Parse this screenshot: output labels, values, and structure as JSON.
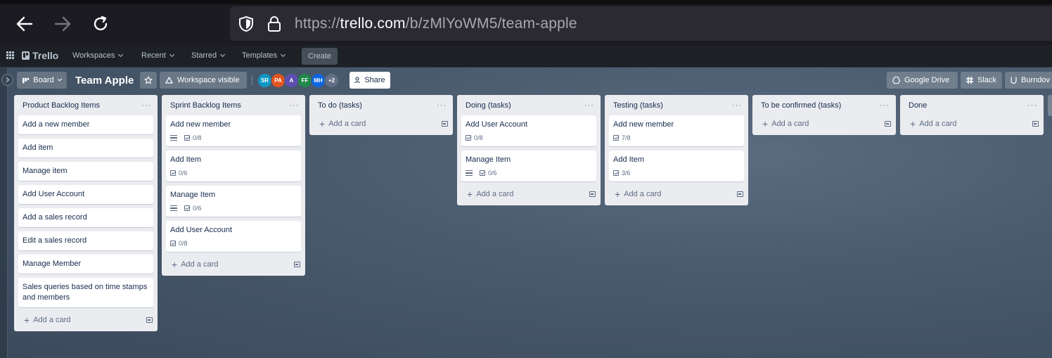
{
  "browser": {
    "url_host": "trello.com",
    "url_prefix": "https://",
    "url_path": "/b/zMlYoWM5/team-apple"
  },
  "header": {
    "logo": "Trello",
    "menus": [
      "Workspaces",
      "Recent",
      "Starred",
      "Templates"
    ],
    "create_label": "Create"
  },
  "board": {
    "view_label": "Board",
    "title": "Team Apple",
    "visibility_label": "Workspace visible",
    "members": [
      {
        "initials": "SR",
        "color": "#0e97c4"
      },
      {
        "initials": "PA",
        "color": "#e3541e"
      },
      {
        "initials": "A",
        "color": "#5e4db2"
      },
      {
        "initials": "FF",
        "color": "#1f8a4c"
      },
      {
        "initials": "MH",
        "color": "#0c66e4"
      },
      {
        "initials": "+2",
        "color": "#626f86"
      }
    ],
    "share_label": "Share",
    "powerups": [
      "Google Drive",
      "Slack",
      "Burndov"
    ]
  },
  "lists": [
    {
      "title": "Product Backlog Items",
      "cards": [
        {
          "title": "Add a new member"
        },
        {
          "title": "Add item"
        },
        {
          "title": "Manage item"
        },
        {
          "title": "Add User Account"
        },
        {
          "title": "Add a sales record"
        },
        {
          "title": "Edit a sales record"
        },
        {
          "title": "Manage Member"
        },
        {
          "title": "Sales queries based on time stamps and members"
        }
      ],
      "add_label": "Add a card"
    },
    {
      "title": "Sprint Backlog Items",
      "cards": [
        {
          "title": "Add new member",
          "desc": true,
          "checklist": "0/8"
        },
        {
          "title": "Add Item",
          "checklist": "0/6"
        },
        {
          "title": "Manage Item",
          "desc": true,
          "checklist": "0/6"
        },
        {
          "title": "Add User Account",
          "checklist": "0/8"
        }
      ],
      "add_label": "Add a card"
    },
    {
      "title": "To do (tasks)",
      "cards": [],
      "add_label": "Add a card"
    },
    {
      "title": "Doing (tasks)",
      "cards": [
        {
          "title": "Add User Account",
          "checklist": "0/8"
        },
        {
          "title": "Manage Item",
          "desc": true,
          "checklist": "0/6"
        }
      ],
      "add_label": "Add a card"
    },
    {
      "title": "Testing (tasks)",
      "cards": [
        {
          "title": "Add new member",
          "checklist": "7/8"
        },
        {
          "title": "Add Item",
          "checklist": "3/6"
        }
      ],
      "add_label": "Add a card"
    },
    {
      "title": "To be confirmed (tasks)",
      "cards": [],
      "add_label": "Add a card"
    },
    {
      "title": "Done",
      "cards": [],
      "add_label": "Add a card"
    }
  ]
}
